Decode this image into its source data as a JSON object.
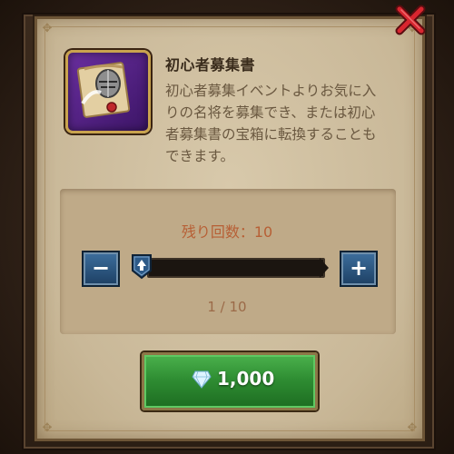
{
  "item": {
    "title": "初心者募集書",
    "description": "初心者募集イベントよりお気に入りの名将を募集でき、または初心者募集書の宝箱に転換することもできます。",
    "icon": "recruitment-scroll-helmet-icon"
  },
  "quantity": {
    "remaining_label": "残り回数：10",
    "counter_text": "1 / 10",
    "current": 1,
    "max": 10
  },
  "buttons": {
    "minus_label": "−",
    "plus_label": "+"
  },
  "purchase": {
    "price": "1,000",
    "currency_icon": "diamond-icon"
  },
  "colors": {
    "panel": "#cdbd9f",
    "buy_green": "#2f8e33",
    "remaining_text": "#b75f35",
    "close_red": "#c4212a"
  }
}
